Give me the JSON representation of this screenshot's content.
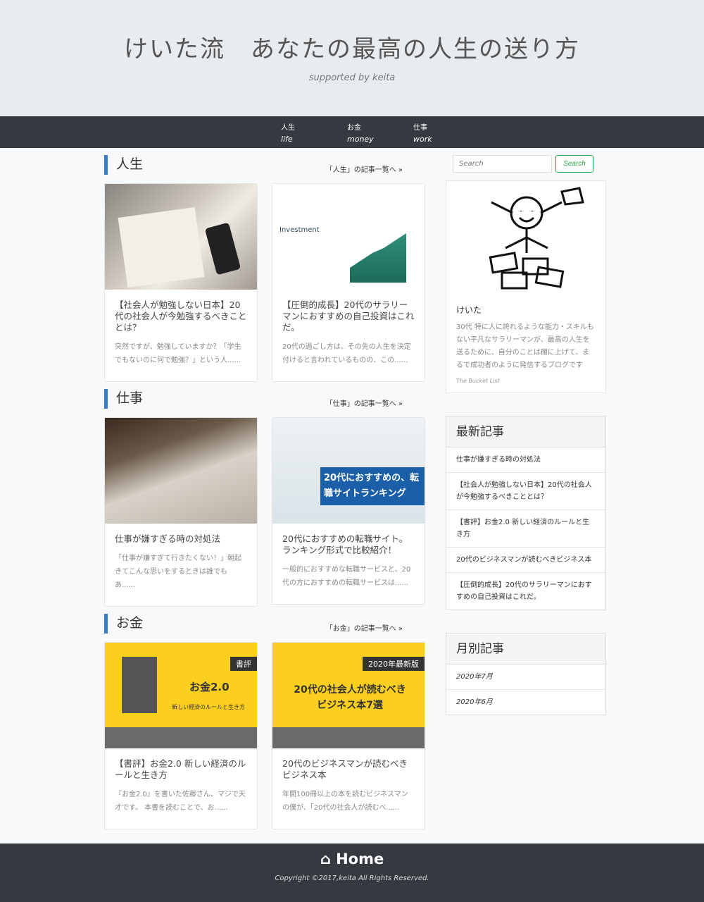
{
  "header": {
    "title": "けいた流　あなたの最高の人生の送り方",
    "subtitle": "supported by keita"
  },
  "nav": [
    {
      "label": "人生",
      "sub": "life"
    },
    {
      "label": "お金",
      "sub": "money"
    },
    {
      "label": "仕事",
      "sub": "work"
    }
  ],
  "sections": [
    {
      "title": "人生",
      "more": "「人生」の記事一覧へ »",
      "cards": [
        {
          "title": "【社会人が勉強しない日本】20代の社会人が今勉強するべきこととは？",
          "excerpt": "突然ですが、勉強していますか？「学生でもないのに何で勉強？」という人......"
        },
        {
          "title": "【圧倒的成長】20代のサラリーマンにおすすめの自己投資はこれだ。",
          "excerpt": "20代の過ごし方は、その先の人生を決定付けると言われているものの、この......",
          "image_text": "Investment"
        }
      ]
    },
    {
      "title": "仕事",
      "more": "「仕事」の記事一覧へ »",
      "cards": [
        {
          "title": "仕事が嫌すぎる時の対処法",
          "excerpt": "「仕事が嫌すぎて行きたくない！」朝起きてこんな思いをするときは誰でもあ......"
        },
        {
          "title": "20代におすすめの転職サイト。ランキング形式で比較紹介！",
          "excerpt": "一般的におすすめな転職サービスと、20代の方におすすめの転職サービスは......",
          "image_text": "20代におすすめの、転職サイトランキング"
        }
      ]
    },
    {
      "title": "お金",
      "more": "「お金」の記事一覧へ »",
      "cards": [
        {
          "title": "【書評】お金2.0 新しい経済のルールと生き方",
          "excerpt": "『お金2.0』を書いた佐藤さん、マジで天才です。 本書を読むことで、お......",
          "image_text": "お金2.0",
          "image_badge": "書評",
          "image_sub": "新しい経済のルールと生き方"
        },
        {
          "title": "20代のビジネスマンが読むべきビジネス本",
          "excerpt": "年間100冊以上の本を読むビジネスマンの僕が、「20代の社会人が読むべ......",
          "image_text": "20代の社会人が読むべきビジネス本7選",
          "image_badge": "2020年最新版"
        }
      ]
    }
  ],
  "sidebar": {
    "search_placeholder": "Search",
    "search_button": "Search",
    "profile": {
      "name": "けいた",
      "desc": "30代 特に人に誇れるような能力・スキルもない平凡なサラリーマンが、最高の人生を送るために、自分のことは棚に上げて、まるで成功者のように発信するブログです",
      "blog": "The Bucket List"
    },
    "recent_title": "最新記事",
    "recent": [
      "仕事が嫌すぎる時の対処法",
      "【社会人が勉強しない日本】20代の社会人が今勉強するべきこととは？",
      "【書評】お金2.0 新しい経済のルールと生き方",
      "20代のビジネスマンが読むべきビジネス本",
      "【圧倒的成長】20代のサラリーマンにおすすめの自己投資はこれだ。"
    ],
    "monthly_title": "月別記事",
    "monthly": [
      "2020年7月",
      "2020年6月"
    ]
  },
  "footer": {
    "home": "Home",
    "copyright": "Copyright ©2017,keita All Rights Reserved."
  }
}
